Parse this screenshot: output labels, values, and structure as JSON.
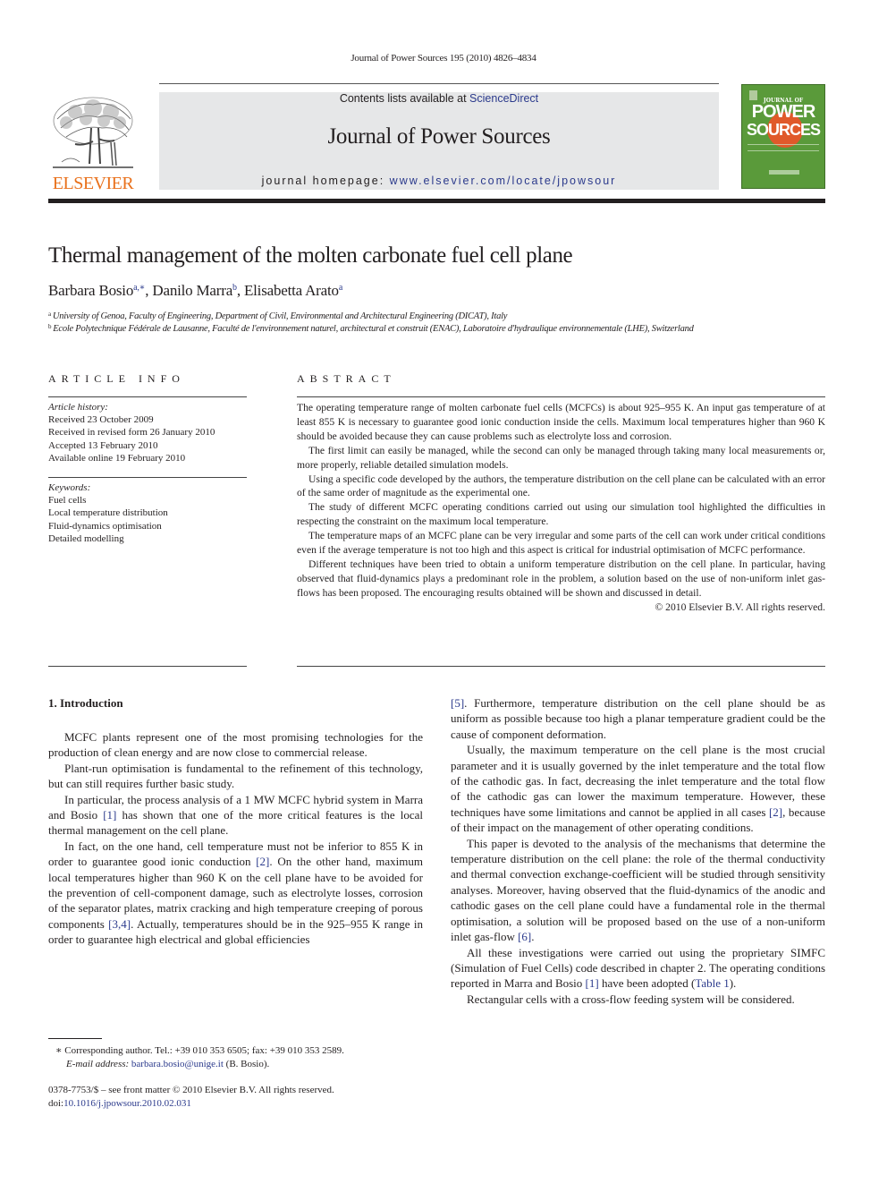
{
  "header": {
    "running_head": "Journal of Power Sources 195 (2010) 4826–4834",
    "contents_prefix": "Contents lists available at ",
    "contents_link": "ScienceDirect",
    "journal_title": "Journal of Power Sources",
    "homepage_prefix": "journal homepage: ",
    "homepage_link": "www.elsevier.com/locate/jpowsour",
    "publisher_logo_text": "ELSEVIER",
    "cover": {
      "line1": "JOURNAL OF",
      "line2": "POWER",
      "line3": "SOURCES"
    },
    "colors": {
      "link": "#2b3a8c",
      "elsevier_orange": "#e9711c",
      "banner_bg": "#e6e7e8",
      "cover_green": "#5a9a3a"
    }
  },
  "article": {
    "title": "Thermal management of the molten carbonate fuel cell plane",
    "authors": [
      {
        "name": "Barbara Bosio",
        "sup": "a,∗"
      },
      {
        "name": "Danilo Marra",
        "sup": "b"
      },
      {
        "name": "Elisabetta Arato",
        "sup": "a"
      }
    ],
    "affiliations": [
      {
        "sup": "a",
        "text": "University of Genoa, Faculty of Engineering, Department of Civil, Environmental and Architectural Engineering (DICAT), Italy"
      },
      {
        "sup": "b",
        "text": "Ecole Polytechnique Fédérale de Lausanne, Faculté de l'environnement naturel, architectural et construit (ENAC), Laboratoire d'hydraulique environnementale (LHE), Switzerland"
      }
    ]
  },
  "article_info": {
    "heading": "ARTICLE INFO",
    "history_label": "Article history:",
    "history": [
      "Received 23 October 2009",
      "Received in revised form 26 January 2010",
      "Accepted 13 February 2010",
      "Available online 19 February 2010"
    ],
    "keywords_label": "Keywords:",
    "keywords": [
      "Fuel cells",
      "Local temperature distribution",
      "Fluid-dynamics optimisation",
      "Detailed modelling"
    ]
  },
  "abstract": {
    "heading": "ABSTRACT",
    "paragraphs": [
      "The operating temperature range of molten carbonate fuel cells (MCFCs) is about 925–955 K. An input gas temperature of at least 855 K is necessary to guarantee good ionic conduction inside the cells. Maximum local temperatures higher than 960 K should be avoided because they can cause problems such as electrolyte loss and corrosion.",
      "The first limit can easily be managed, while the second can only be managed through taking many local measurements or, more properly, reliable detailed simulation models.",
      "Using a specific code developed by the authors, the temperature distribution on the cell plane can be calculated with an error of the same order of magnitude as the experimental one.",
      "The study of different MCFC operating conditions carried out using our simulation tool highlighted the difficulties in respecting the constraint on the maximum local temperature.",
      "The temperature maps of an MCFC plane can be very irregular and some parts of the cell can work under critical conditions even if the average temperature is not too high and this aspect is critical for industrial optimisation of MCFC performance.",
      "Different techniques have been tried to obtain a uniform temperature distribution on the cell plane. In particular, having observed that fluid-dynamics plays a predominant role in the problem, a solution based on the use of non-uniform inlet gas-flows has been proposed. The encouraging results obtained will be shown and discussed in detail."
    ],
    "copyright": "© 2010 Elsevier B.V. All rights reserved."
  },
  "introduction": {
    "heading": "1.  Introduction",
    "left": {
      "p1": "MCFC plants represent one of the most promising technologies for the production of clean energy and are now close to commercial release.",
      "p2": "Plant-run optimisation is fundamental to the refinement of this technology, but can still requires further basic study.",
      "p3a": "In particular, the process analysis of a 1 MW MCFC hybrid system in Marra and Bosio ",
      "p3_ref": "[1]",
      "p3b": " has shown that one of the more critical features is the local thermal management on the cell plane.",
      "p4a": "In fact, on the one hand, cell temperature must not be inferior to 855 K in order to guarantee good ionic conduction ",
      "p4_ref1": "[2]",
      "p4b": ". On the other hand, maximum local temperatures higher than 960 K on the cell plane have to be avoided for the prevention of cell-component damage, such as electrolyte losses, corrosion of the separator plates, matrix cracking and high temperature creeping of porous components ",
      "p4_ref2": "[3,4]",
      "p4c": ". Actually, temperatures should be in the 925–955 K range in order to guarantee high electrical and global efficiencies"
    },
    "right": {
      "p0_ref": "[5]",
      "p0": ". Furthermore, temperature distribution on the cell plane should be as uniform as possible because too high a planar temperature gradient could be the cause of component deformation.",
      "p1a": "Usually, the maximum temperature on the cell plane is the most crucial parameter and it is usually governed by the inlet temperature and the total flow of the cathodic gas. In fact, decreasing the inlet temperature and the total flow of the cathodic gas can lower the maximum temperature. However, these techniques have some limitations and cannot be applied in all cases ",
      "p1_ref": "[2]",
      "p1b": ", because of their impact on the management of other operating conditions.",
      "p2a": "This paper is devoted to the analysis of the mechanisms that determine the temperature distribution on the cell plane: the role of the thermal conductivity and thermal convection exchange-coefficient will be studied through sensitivity analyses. Moreover, having observed that the fluid-dynamics of the anodic and cathodic gases on the cell plane could have a fundamental role in the thermal optimisation, a solution will be proposed based on the use of a non-uniform inlet gas-flow ",
      "p2_ref": "[6]",
      "p2b": ".",
      "p3a": "All these investigations were carried out using the proprietary SIMFC (Simulation of Fuel Cells) code described in chapter 2. The operating conditions reported in Marra and Bosio ",
      "p3_ref1": "[1]",
      "p3b": " have been adopted (",
      "p3_ref2": "Table 1",
      "p3c": ").",
      "p4": "Rectangular cells with a cross-flow feeding system will be considered."
    }
  },
  "footnote": {
    "marker": "∗",
    "corresponding": " Corresponding author. Tel.: +39 010 353 6505; fax: +39 010 353 2589.",
    "email_label": "E-mail address:",
    "email": "barbara.bosio@unige.it",
    "email_suffix": " (B. Bosio)."
  },
  "front_matter": {
    "issn_line": "0378-7753/$ – see front matter © 2010 Elsevier B.V. All rights reserved.",
    "doi_prefix": "doi:",
    "doi": "10.1016/j.jpowsour.2010.02.031"
  }
}
